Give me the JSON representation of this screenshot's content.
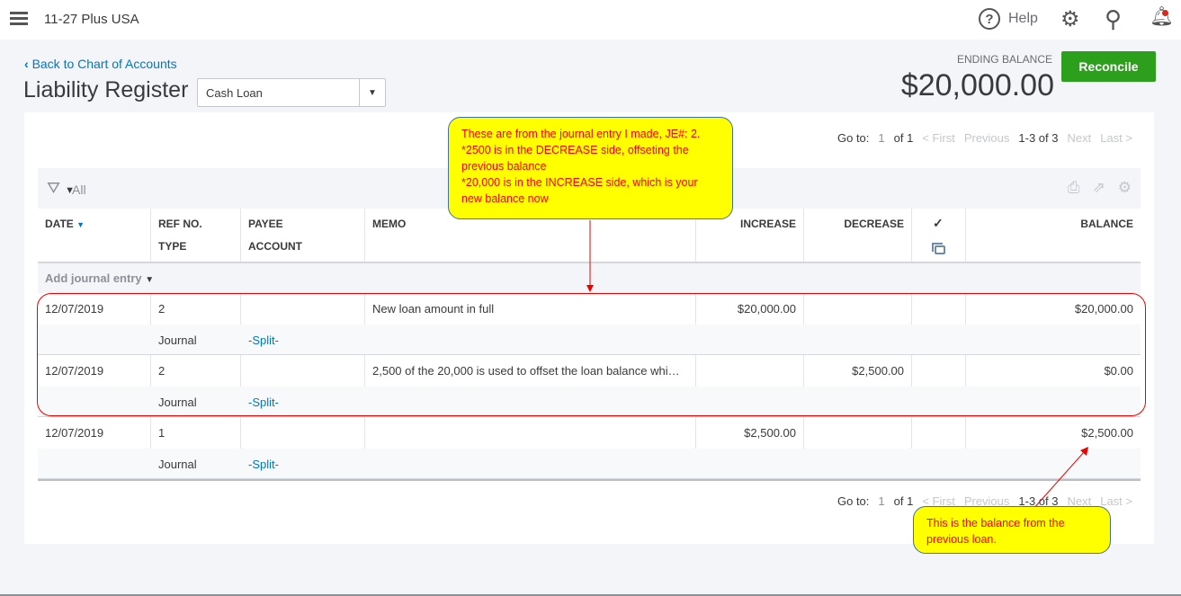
{
  "topbar": {
    "company": "11-27 Plus USA",
    "help_label": "Help"
  },
  "header": {
    "back_link": "Back to Chart of Accounts",
    "title": "Liability Register",
    "account": "Cash Loan",
    "ending_balance_label": "ENDING BALANCE",
    "ending_balance": "$20,000.00",
    "reconcile_label": "Reconcile"
  },
  "pager_top": {
    "goto": "Go to:",
    "page": "1",
    "of": "of 1",
    "first": "< First",
    "previous": "Previous",
    "range": "1-3 of 3",
    "next": "Next",
    "last": "Last >"
  },
  "pager_bottom": {
    "goto": "Go to:",
    "page": "1",
    "of": "of 1",
    "first": "< First",
    "previous": "Previous",
    "range": "1-3 of 3",
    "next": "Next",
    "last": "Last >"
  },
  "filter": {
    "label": "All"
  },
  "columns": {
    "date": "DATE",
    "ref": "REF NO.",
    "type": "TYPE",
    "payee": "PAYEE",
    "account": "ACCOUNT",
    "memo": "MEMO",
    "increase": "INCREASE",
    "decrease": "DECREASE",
    "check": "✓",
    "balance": "BALANCE"
  },
  "add_entry": "Add journal entry",
  "rows": [
    {
      "date": "12/07/2019",
      "ref": "2",
      "memo": "New loan amount in full",
      "increase": "$20,000.00",
      "decrease": "",
      "balance": "$20,000.00",
      "type": "Journal",
      "account": "-Split-"
    },
    {
      "date": "12/07/2019",
      "ref": "2",
      "memo": "2,500 of the 20,000 is used to offset the loan balance whi…",
      "increase": "",
      "decrease": "$2,500.00",
      "balance": "$0.00",
      "type": "Journal",
      "account": "-Split-"
    },
    {
      "date": "12/07/2019",
      "ref": "1",
      "memo": "",
      "increase": "$2,500.00",
      "decrease": "",
      "balance": "$2,500.00",
      "type": "Journal",
      "account": "-Split-"
    }
  ],
  "annotations": {
    "note1": [
      "These are from the journal entry I made, JE#: 2.",
      "*2500 is in the DECREASE side, offseting the previous balance",
      "*20,000 is in the INCREASE side, which is your new balance now"
    ],
    "note2": "This is the balance from the previous loan."
  }
}
